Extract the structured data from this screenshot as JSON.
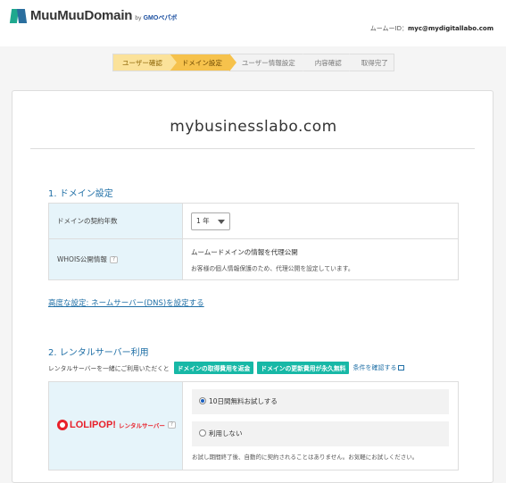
{
  "header": {
    "logo_text": "MuuMuuDomain",
    "logo_by": "by",
    "logo_gmo": "GMOペパボ",
    "user_id_label": "ムームーID：",
    "user_id_value": "myc@mydigitallabo.com"
  },
  "steps": [
    {
      "label": "ユーザー確認",
      "state": "done"
    },
    {
      "label": "ドメイン設定",
      "state": "active"
    },
    {
      "label": "ユーザー情報設定",
      "state": "todo"
    },
    {
      "label": "内容確認",
      "state": "todo"
    },
    {
      "label": "取得完了",
      "state": "todo"
    }
  ],
  "domain_name": "mybusinesslabo.com",
  "section1": {
    "title": "1. ドメイン設定",
    "contract_years_label": "ドメインの契約年数",
    "contract_years_value": "1 年",
    "whois_label": "WHOIS公開情報",
    "help_icon": "?",
    "whois_main": "ムームードメインの情報を代理公開",
    "whois_sub": "お客様の個人情報保護のため、代理公開を設定しています。",
    "advanced_link": "高度な設定: ネームサーバー(DNS)を設定する"
  },
  "section2": {
    "title": "2. レンタルサーバー利用",
    "rental_text": "レンタルサーバーを一緒にご利用いただくと",
    "badge1": "ドメインの取得費用を返金",
    "badge2": "ドメインの更新費用が永久無料",
    "condition_link": "条件を確認する",
    "lolipop_name": "LOLIPOP!",
    "lolipop_sub": "レンタルサーバー",
    "option1": "10日間無料お試しする",
    "option2": "利用しない",
    "option_selected": "option1",
    "note": "お試し期間終了後、自動的に契約されることはありません。お気軽にお試しください。"
  },
  "colors": {
    "accent_teal": "#17b8a6",
    "link_blue": "#1f6fa6",
    "step_active": "#f6c24c",
    "lolipop_red": "#e8202a"
  }
}
